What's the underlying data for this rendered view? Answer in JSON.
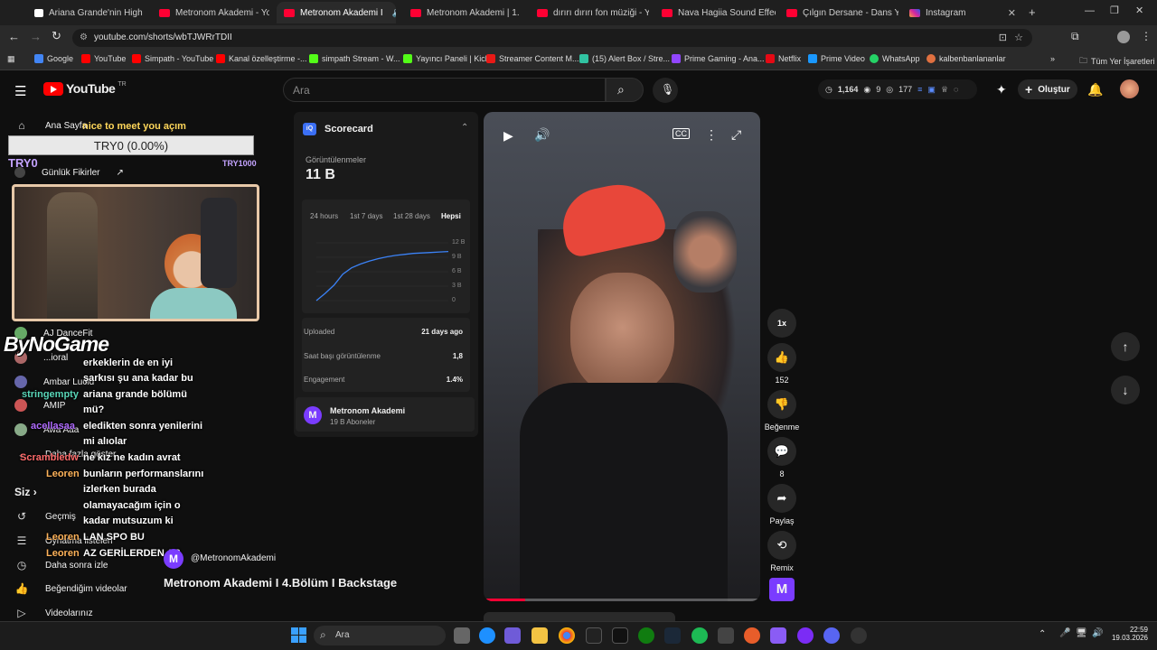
{
  "browser": {
    "tabs": [
      {
        "label": "Ariana Grande'nin High N",
        "x": 0
      },
      {
        "label": "Metronom Akademi - You",
        "x": 0
      },
      {
        "label": "Metronom Akademi I",
        "x": 0
      },
      {
        "label": "Metronom Akademi | 1. B",
        "x": 0
      },
      {
        "label": "dırırı dırırı fon müziği - Yo",
        "x": 0
      },
      {
        "label": "Nava Hagiia Sound Effect",
        "x": 0
      },
      {
        "label": "Çılgın Dersane - Dans Yar",
        "x": 0
      },
      {
        "label": "Instagram",
        "x": 0
      }
    ],
    "url": "youtube.com/shorts/wbTJWRrTDII",
    "bookmarks": [
      "Google",
      "YouTube",
      "Simpath - YouTube",
      "Kanal özelleştirme -...",
      "simpath Stream - W...",
      "Yayıncı Paneli | Kick",
      "Streamer Content M...",
      "(15) Alert Box / Stre...",
      "Prime Gaming - Ana...",
      "Netflix",
      "Prime Video",
      "WhatsApp",
      "kalbenbanlananlar"
    ],
    "all_bookmarks": "Tüm Yer İşaretleri"
  },
  "youtube": {
    "logo_text": "YouTube",
    "logo_region": "TR",
    "search_placeholder": "Ara",
    "stats": {
      "views": "1,164",
      "a": "9",
      "b": "177"
    },
    "create_label": "Oluştur"
  },
  "sidebar": {
    "home": "Ana Sayfa",
    "shorts_partial": "Günlük Fikirler",
    "subs": [
      "AJ DanceFit",
      "...ioral",
      "Ambar Lucid",
      "AMIP",
      "Awa Aaa"
    ],
    "show_more": "Daha fazla göster",
    "you": "Siz",
    "history": "Geçmiş",
    "playlists": "Oynatma listeleri",
    "watch_later": "Daha sonra izle",
    "liked": "Beğendiğim videolar",
    "your_videos": "Videolarınız"
  },
  "overlay": {
    "greeting": "nice to meet you açım",
    "goal_text": "TRY0 (0.00%)",
    "goal_left": "TRY0",
    "goal_right": "TRY1000",
    "brand": "ByNoGame",
    "chat_names": [
      "stringempty",
      "acellasaa",
      "Scrambledw",
      "Leoren",
      "Leoren",
      "Leoren"
    ],
    "chat_lines": [
      "erkeklerin de en iyi",
      "şarkısı şu ana kadar bu",
      "ariana grande bölümü",
      "mü?",
      "eledikten sonra yenilerini",
      "mi alıolar",
      "ne kız ne kadın avrat",
      "bunların performanslarını",
      "izlerken burada",
      "olamayacağım için o",
      "kadar mutsuzum ki",
      "LAN SPO BU",
      "AZ GERİLERDEN AS"
    ]
  },
  "scorecard": {
    "title": "Scorecard",
    "views_label": "Görüntülenmeler",
    "views_value": "11 B",
    "ranges": [
      "24 hours",
      "1st 7 days",
      "1st 28 days",
      "Hepsi"
    ],
    "active_range": "Hepsi",
    "y_ticks": [
      "12 B",
      "9 B",
      "6 B",
      "3 B",
      "0"
    ],
    "uploaded_label": "Uploaded",
    "uploaded_value": "21 days ago",
    "hourly_label": "Saat başı görüntülenme",
    "hourly_value": "1,8",
    "engagement_label": "Engagement",
    "engagement_value": "1.4%",
    "channel_name": "Metronom Akademi",
    "channel_subs": "19 B Aboneler",
    "series": [
      0,
      1.5,
      3.2,
      5.5,
      6.8,
      7.6,
      8.2,
      8.7,
      9.1,
      9.4,
      9.6,
      9.8,
      9.9,
      10.0,
      10.1,
      10.2
    ]
  },
  "short": {
    "handle": "@MetronomAkademi",
    "title": "Metronom Akademi I 4.Bölüm I Backstage",
    "speed": "1x",
    "likes": "152",
    "dislike": "Beğenme",
    "comments": "8",
    "share": "Paylaş",
    "remix": "Remix"
  },
  "taskbar": {
    "search": "Ara",
    "time": "22:59",
    "date": "19.03.2026"
  }
}
